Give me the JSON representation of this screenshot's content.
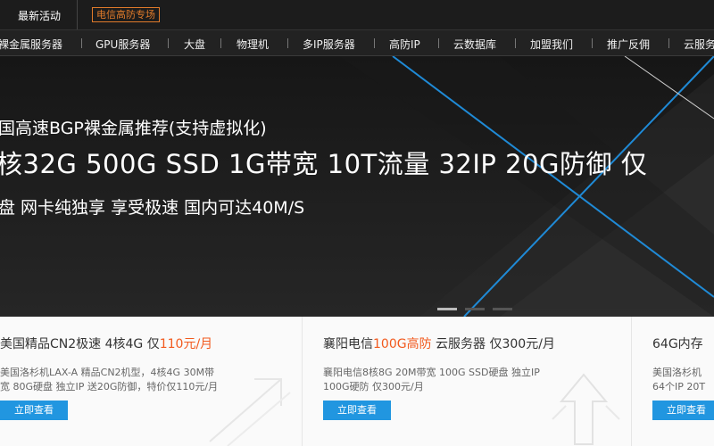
{
  "topbar": {
    "latest_activity": "最新活动",
    "promo_tag": "电信高防专场"
  },
  "nav": {
    "items": [
      "裸金属服务器",
      "GPU服务器",
      "大盘",
      "物理机",
      "多IP服务器",
      "高防IP",
      "云数据库",
      "加盟我们",
      "推广反佣",
      "云服务器"
    ]
  },
  "hero": {
    "line1": "国高速BGP裸金属推荐(支持虚拟化)",
    "line2": "核32G 500G SSD 1G带宽 10T流量 32IP 20G防御 仅",
    "line3": "盘 网卡纯独享 享受极速 国内可达40M/S",
    "slide_count": 3,
    "active_slide": 1
  },
  "cards": [
    {
      "title_prefix": "美国精品CN2极速 4核4G 仅",
      "title_highlight": "110元/月",
      "title_suffix": "",
      "desc1": "美国洛杉机LAX-A 精品CN2机型，4核4G 30M带",
      "desc2": "宽 80G硬盘 独立IP 送20G防御，特价仅110元/月",
      "button": "立即查看"
    },
    {
      "title_prefix": "襄阳电信",
      "title_highlight": "100G高防",
      "title_suffix": " 云服务器 仅300元/月",
      "desc1": "襄阳电信8核8G 20M带宽 100G SSD硬盘 独立IP",
      "desc2": "100G硬防 仅300元/月",
      "button": "立即查看"
    },
    {
      "title_prefix": "64G内存",
      "title_highlight": "",
      "title_suffix": "",
      "desc1": "美国洛杉机",
      "desc2": "64个IP 20T",
      "button": "立即查看"
    }
  ],
  "colors": {
    "accent": "#f25a1e",
    "button": "#2196e0",
    "promo_tag": "#e07a2a",
    "hero_line": "#1f8ad6"
  }
}
